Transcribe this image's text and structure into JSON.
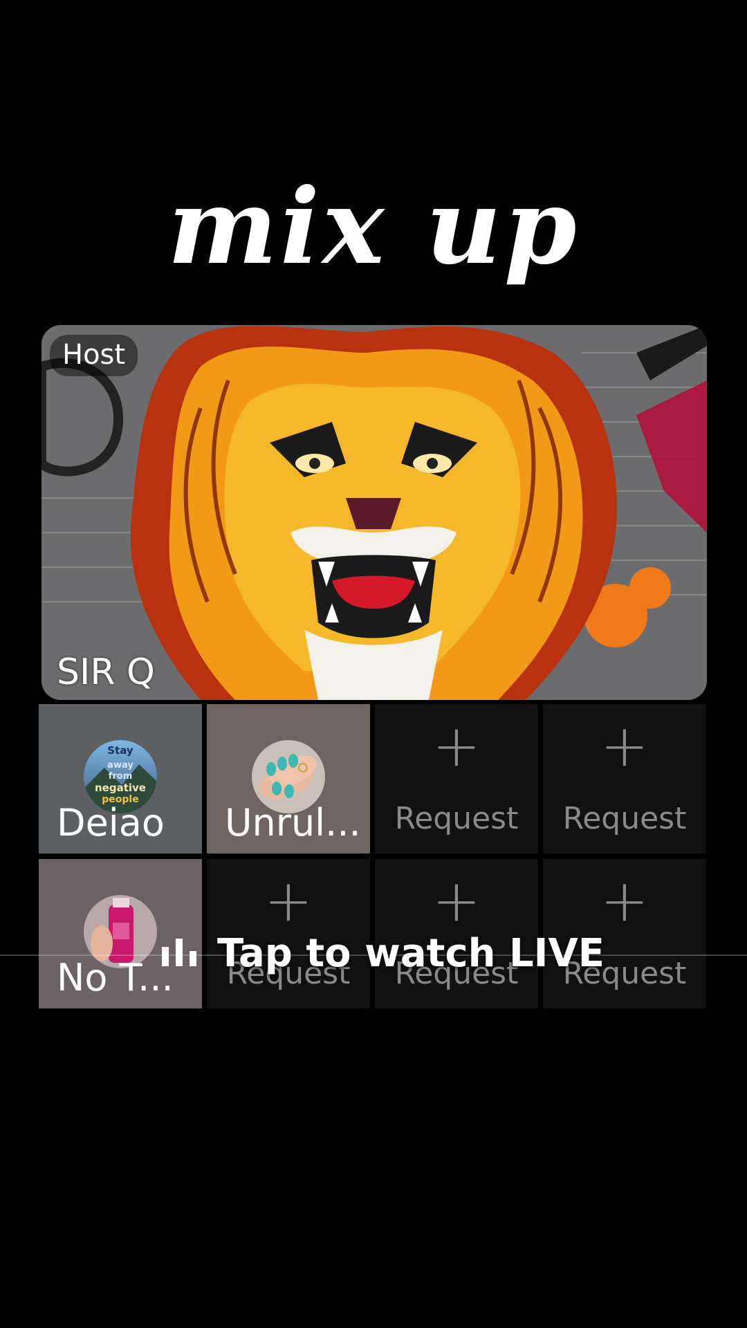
{
  "stream": {
    "title": "mix up"
  },
  "host": {
    "badge": "Host",
    "name": "SIR Q"
  },
  "guests": [
    {
      "name": "Deiao",
      "avatar_text": [
        "Stay",
        "away",
        "from",
        "negative",
        "people"
      ]
    },
    {
      "name": "Unrul..."
    },
    {
      "name": "No T..."
    }
  ],
  "empty_slot": {
    "icon": "plus-icon",
    "label": "Request"
  },
  "overlay": {
    "cta": "Tap to watch LIVE",
    "icon": "audio-bars-icon"
  },
  "colors": {
    "background": "#000000",
    "slot_empty": "#111111",
    "muted_text": "#8a8a8a"
  }
}
